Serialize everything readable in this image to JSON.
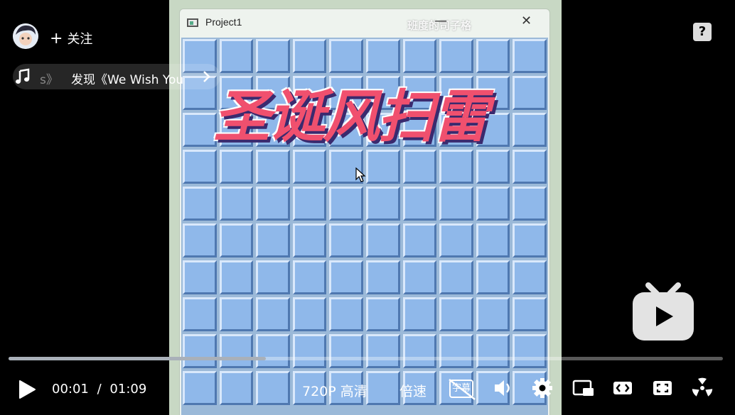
{
  "user": {
    "follow_label": "关注"
  },
  "music": {
    "prefix": "s》",
    "text": "发现《We Wish You"
  },
  "help": {
    "label": "?"
  },
  "video": {
    "window_title": "Project1",
    "watermark": "班度的司子格",
    "game_title": "圣诞风扫雷",
    "grid": {
      "rows": 10,
      "cols": 10
    }
  },
  "player": {
    "current_time": "00:01",
    "separator": "/",
    "duration": "01:09",
    "progress": 0.36,
    "quality": "720P 高清",
    "speed": "倍速",
    "subtitle_label": "字幕"
  },
  "icons": [
    "avatar",
    "plus-icon",
    "music-note-icon",
    "chevron-right-icon",
    "help-icon",
    "bilibili-tv-icon",
    "play-icon",
    "subtitle-off-icon",
    "volume-icon",
    "settings-gear-icon",
    "pip-icon",
    "widescreen-icon",
    "fullscreen-icon",
    "radiation-icon"
  ]
}
